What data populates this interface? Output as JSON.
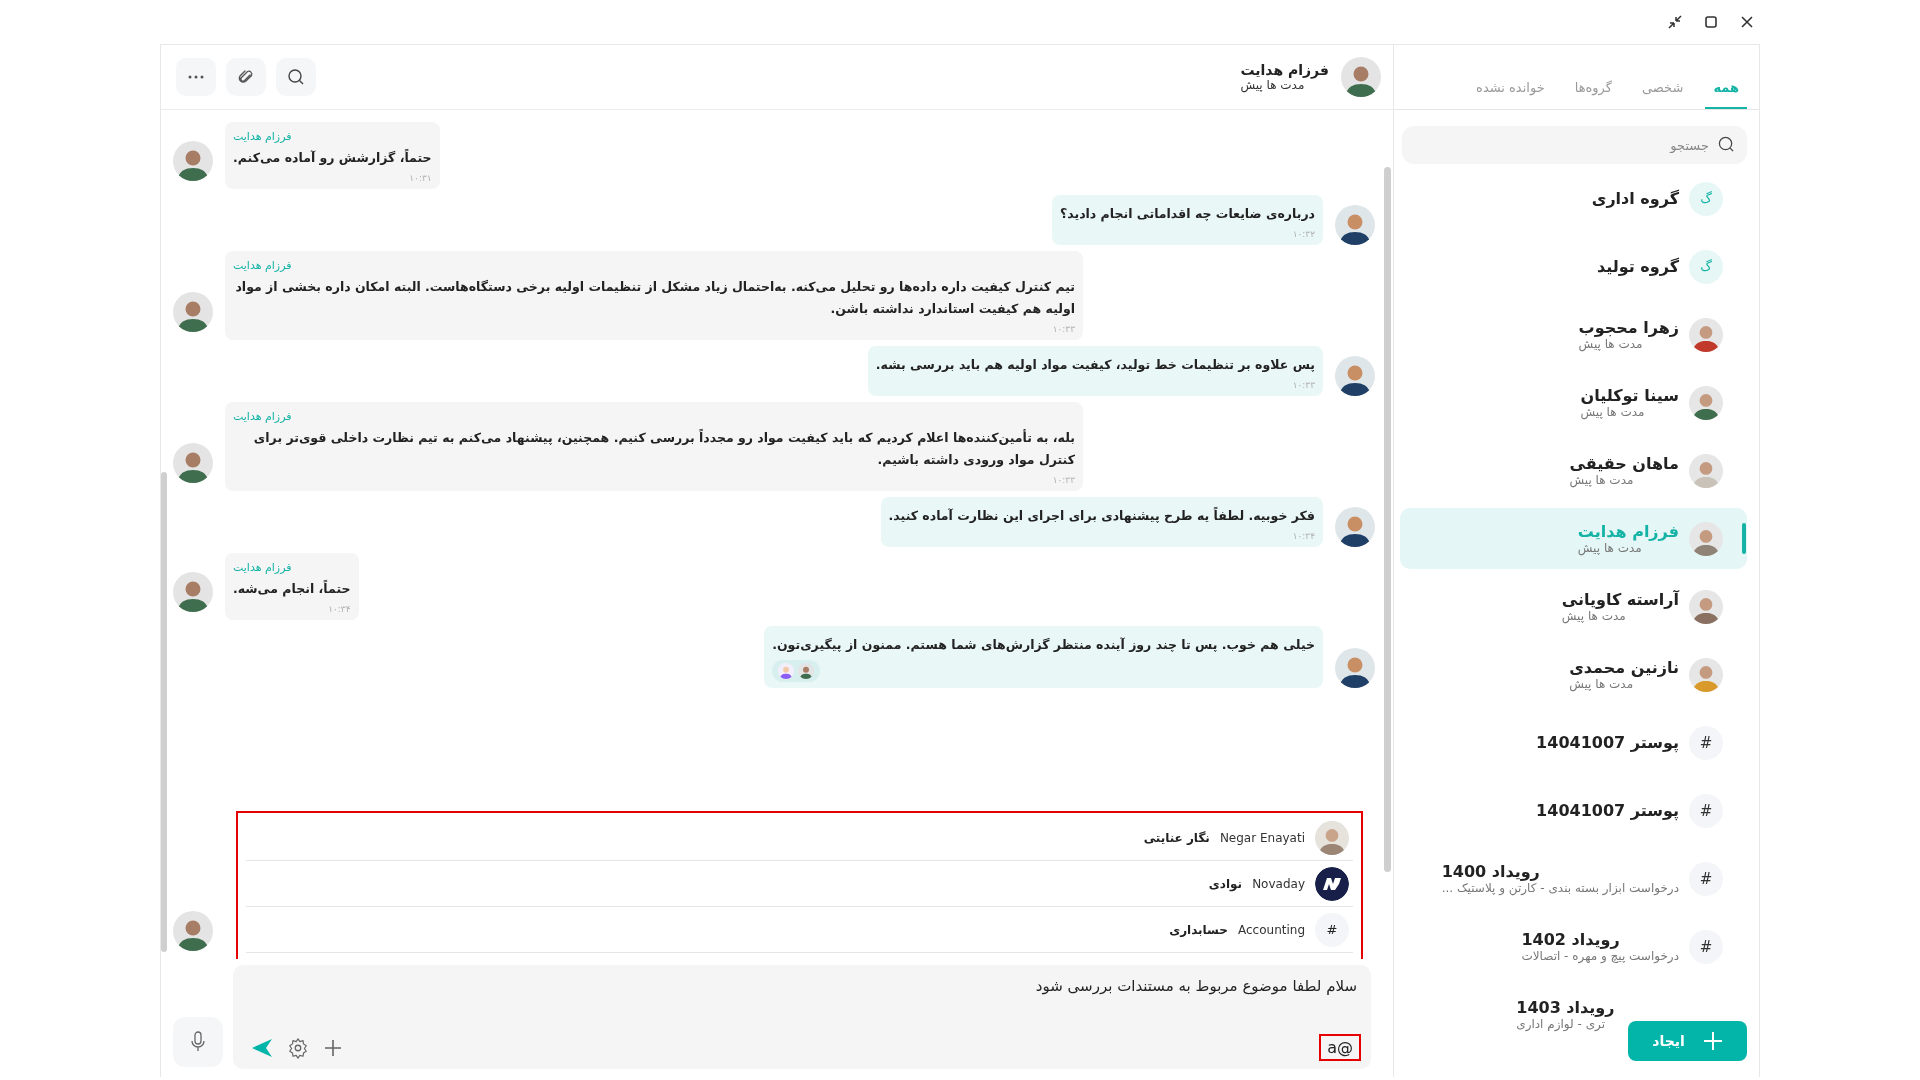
{
  "chat_header": {
    "name": "فرزام هدایت",
    "status": "مدت ها پیش"
  },
  "messages": [
    {
      "kind": "incoming",
      "sender": "فرزام هدایت",
      "text": "حتماً، گزارشش رو آماده می‌کنم.",
      "time": "۱۰:۳۱"
    },
    {
      "kind": "outgoing",
      "text": "درباره‌ی ضایعات چه اقداماتی انجام دادید؟",
      "time": "۱۰:۳۲"
    },
    {
      "kind": "incoming",
      "sender": "فرزام هدایت",
      "text": "تیم کنترل کیفیت داره داده‌ها رو تحلیل می‌کنه. به‌احتمال زیاد مشکل از تنظیمات اولیه برخی دستگاه‌هاست. البته امکان داره بخشی از مواد اولیه هم کیفیت استاندارد نداشته باشن.",
      "time": "۱۰:۳۳"
    },
    {
      "kind": "outgoing",
      "text": "پس علاوه بر تنظیمات خط تولید، کیفیت مواد اولیه هم باید بررسی بشه.",
      "time": "۱۰:۳۳"
    },
    {
      "kind": "incoming",
      "sender": "فرزام هدایت",
      "text": "بله، به تأمین‌کننده‌ها اعلام کردیم که باید کیفیت مواد رو مجدداً بررسی کنیم. همچنین، پیشنهاد می‌کنم به تیم نظارت داخلی قوی‌تر برای کنترل مواد ورودی داشته باشیم.",
      "time": "۱۰:۳۳"
    },
    {
      "kind": "outgoing",
      "text": "فکر خوبیه. لطفاً یه طرح پیشنهادی برای اجرای این نظارت آماده کنید.",
      "time": "۱۰:۳۴"
    },
    {
      "kind": "incoming",
      "sender": "فرزام هدایت",
      "text": "حتماً، انجام می‌شه.",
      "time": "۱۰:۳۴"
    },
    {
      "kind": "outgoing",
      "text": "خیلی هم خوب. پس تا چند روز آینده منتظر گزارش‌های شما هستم. ممنون از پیگیری‌تون.",
      "reactions": [
        {
          "kind": "cartoon"
        },
        {
          "kind": "person"
        }
      ]
    },
    {
      "kind": "covered"
    }
  ],
  "mention_popup": {
    "items": [
      {
        "kind": "person",
        "username": "Negar Enayati",
        "name": "نگار عنایتی"
      },
      {
        "kind": "logo",
        "username": "Novaday",
        "name": "نوادی"
      },
      {
        "kind": "channel",
        "icon": "#",
        "username": "Accounting",
        "name": "حسابداری"
      }
    ]
  },
  "composer": {
    "text": "سلام لطفا موضوع مربوط به مستندات بررسی شود",
    "mention_query": "a@"
  },
  "sidebar": {
    "tabs": [
      {
        "label": "همه",
        "selected": true
      },
      {
        "label": "شخصی",
        "selected": false
      },
      {
        "label": "گروه‌ها",
        "selected": false
      },
      {
        "label": "خوانده نشده",
        "selected": false
      }
    ],
    "search": {
      "placeholder": "جستجو"
    },
    "items": [
      {
        "kind": "group",
        "initial": "گ",
        "name": "گروه اداری",
        "selected": false
      },
      {
        "kind": "group",
        "initial": "گ",
        "name": "گروه تولید",
        "selected": false
      },
      {
        "kind": "person",
        "name": "زهرا محجوب",
        "subtitle": "مدت ها پیش",
        "selected": false
      },
      {
        "kind": "person",
        "name": "سینا توکلیان",
        "subtitle": "مدت ها پیش",
        "selected": false
      },
      {
        "kind": "person",
        "name": "ماهان حقیقی",
        "subtitle": "مدت ها پیش",
        "selected": false
      },
      {
        "kind": "person",
        "name": "فرزام هدایت",
        "subtitle": "مدت ها پیش",
        "selected": true
      },
      {
        "kind": "person",
        "name": "آراسته کاویانی",
        "subtitle": "مدت ها پیش",
        "selected": false
      },
      {
        "kind": "person",
        "name": "نازنین محمدی",
        "subtitle": "مدت ها پیش",
        "selected": false
      },
      {
        "kind": "channel",
        "icon": "#",
        "name": "پوستر 14041007",
        "selected": false
      },
      {
        "kind": "channel",
        "icon": "#",
        "name": "پوستر 14041007",
        "selected": false
      },
      {
        "kind": "channel",
        "icon": "#",
        "name": "رویداد 1400",
        "subtitle": "درخواست ابزار بسته بندی - کارتن و پلاستیک ...",
        "selected": false
      },
      {
        "kind": "channel",
        "icon": "#",
        "name": "رویداد 1402",
        "subtitle": "درخواست پیچ و مهره - اتصالات",
        "selected": false
      },
      {
        "kind": "channel",
        "name": "رویداد 1403",
        "subtitle": "تری - لوازم اداری",
        "selected": false
      }
    ],
    "create_button": "ایجاد"
  }
}
